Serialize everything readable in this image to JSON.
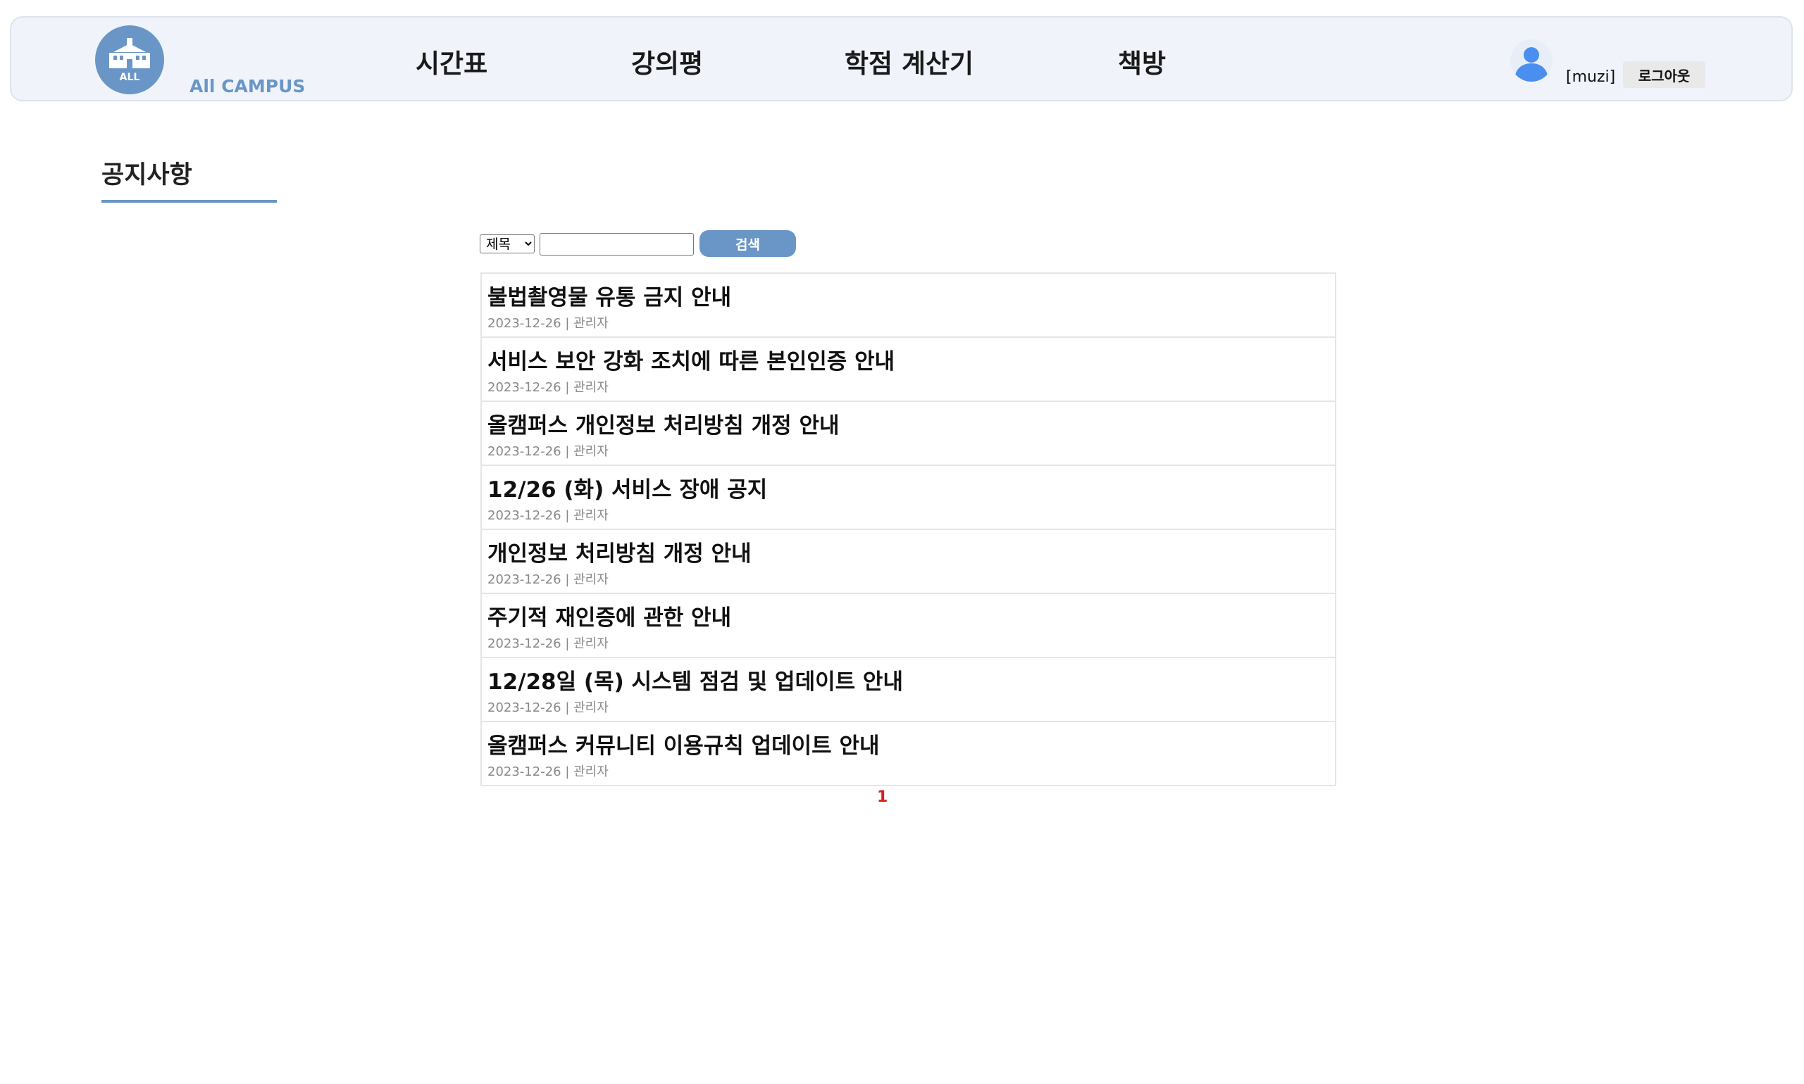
{
  "header": {
    "logo_badge": "ALL",
    "logo_text": "All CAMPUS",
    "nav": [
      {
        "label": "시간표"
      },
      {
        "label": "강의평"
      },
      {
        "label": "학점 계산기"
      },
      {
        "label": "책방"
      }
    ],
    "user": {
      "username": "[muzi]",
      "logout_label": "로그아웃"
    }
  },
  "page": {
    "title": "공지사항"
  },
  "search": {
    "field_selected": "제목",
    "query": "",
    "button_label": "검색"
  },
  "notices": [
    {
      "title": "불법촬영물 유통 금지 안내",
      "meta": "2023-12-26 | 관리자"
    },
    {
      "title": "서비스 보안 강화 조치에 따른 본인인증 안내",
      "meta": "2023-12-26 | 관리자"
    },
    {
      "title": "올캠퍼스 개인정보 처리방침 개정 안내",
      "meta": "2023-12-26 | 관리자"
    },
    {
      "title": "12/26 (화) 서비스 장애 공지",
      "meta": "2023-12-26 | 관리자"
    },
    {
      "title": "개인정보 처리방침 개정 안내",
      "meta": "2023-12-26 | 관리자"
    },
    {
      "title": "주기적 재인증에 관한 안내",
      "meta": "2023-12-26 | 관리자"
    },
    {
      "title": "12/28일 (목) 시스템 점검 및 업데이트 안내",
      "meta": "2023-12-26 | 관리자"
    },
    {
      "title": "올캠퍼스 커뮤니티 이용규칙 업데이트 안내",
      "meta": "2023-12-26 | 관리자"
    }
  ],
  "pagination": {
    "current_page": "1"
  },
  "colors": {
    "accent": "#6a96c7",
    "header_bg": "#f0f4fa",
    "active_page": "#d62020"
  },
  "icons": {
    "logo": "school-building-icon",
    "avatar": "user-avatar-icon",
    "select": "chevron-down-icon"
  }
}
